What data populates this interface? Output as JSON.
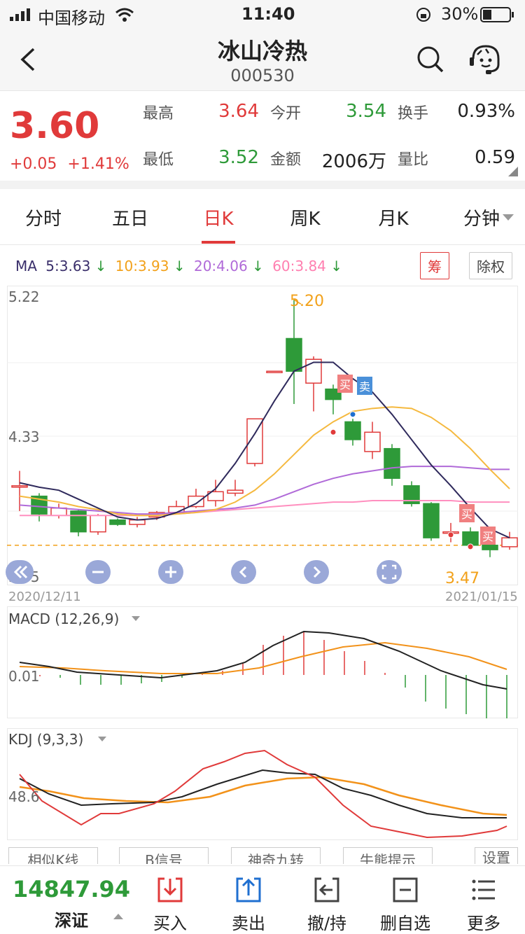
{
  "status": {
    "carrier": "中国移动",
    "time": "11:40",
    "battery": "30%"
  },
  "nav": {
    "title": "冰山冷热",
    "code": "000530"
  },
  "quote": {
    "price": "3.60",
    "change": "+0.05",
    "change_pct": "+1.41%",
    "fields": [
      {
        "label": "最高",
        "value": "3.64",
        "color": "#e03a3a"
      },
      {
        "label": "今开",
        "value": "3.54",
        "color": "#2e9a39"
      },
      {
        "label": "换手",
        "value": "0.93%",
        "color": "#222222"
      },
      {
        "label": "最低",
        "value": "3.52",
        "color": "#2e9a39"
      },
      {
        "label": "金额",
        "value": "2006万",
        "color": "#222222"
      },
      {
        "label": "量比",
        "value": "0.59",
        "color": "#222222"
      }
    ]
  },
  "tabs": {
    "t1": "分时",
    "t2": "五日",
    "t3": "日K",
    "t4": "周K",
    "t5": "月K",
    "t6": "分钟"
  },
  "ma": {
    "label": "MA",
    "items": [
      {
        "text": "5:3.63",
        "color": "#3a2f6b"
      },
      {
        "text": "10:3.93",
        "color": "#f2a11a"
      },
      {
        "text": "20:4.06",
        "color": "#b06ad8"
      },
      {
        "text": "60:3.84",
        "color": "#ff7fb0"
      }
    ],
    "chou": "筹",
    "chuquan": "除权"
  },
  "kline": {
    "y_top": "5.22",
    "y_mid": "4.33",
    "y_low": "3.45",
    "peak_label": "5.20",
    "low_label": "3.47",
    "date_start": "2020/12/11",
    "date_end": "2021/01/15",
    "buy": "买",
    "sell": "卖"
  },
  "macd": {
    "label": "MACD (12,26,9)",
    "value": "0.01"
  },
  "kdj": {
    "label": "KDJ (9,3,3)",
    "value": "48.6"
  },
  "bottom_buttons": {
    "b1": "相似K线",
    "b2": "B信号",
    "b3": "神奇九转",
    "b4": "牛熊提示",
    "b5": "设置"
  },
  "index": {
    "value": "14847.94",
    "name": "深证"
  },
  "toolbar": {
    "buy": "买入",
    "sell": "卖出",
    "cancel": "撤/持",
    "delfav": "删自选",
    "more": "更多"
  },
  "colors": {
    "red": "#e03a3a",
    "green": "#2e9a39",
    "orange": "#f2a11a",
    "blue": "#1f6fd0"
  },
  "chart_data": {
    "type": "candlestick",
    "x_range": [
      "2020/12/11",
      "2021/01/15"
    ],
    "ylim": [
      3.45,
      5.22
    ],
    "candles": [
      {
        "o": 3.95,
        "c": 3.95,
        "h": 4.05,
        "l": 3.78
      },
      {
        "o": 3.88,
        "c": 3.76,
        "h": 3.9,
        "l": 3.71
      },
      {
        "o": 3.75,
        "c": 3.8,
        "h": 3.83,
        "l": 3.73
      },
      {
        "o": 3.78,
        "c": 3.64,
        "h": 3.79,
        "l": 3.61
      },
      {
        "o": 3.64,
        "c": 3.75,
        "h": 3.76,
        "l": 3.62
      },
      {
        "o": 3.72,
        "c": 3.69,
        "h": 3.73,
        "l": 3.68
      },
      {
        "o": 3.69,
        "c": 3.72,
        "h": 3.74,
        "l": 3.67
      },
      {
        "o": 3.74,
        "c": 3.77,
        "h": 3.78,
        "l": 3.72
      },
      {
        "o": 3.77,
        "c": 3.81,
        "h": 3.85,
        "l": 3.76
      },
      {
        "o": 3.81,
        "c": 3.88,
        "h": 3.93,
        "l": 3.8
      },
      {
        "o": 3.85,
        "c": 3.91,
        "h": 3.99,
        "l": 3.81
      },
      {
        "o": 3.9,
        "c": 3.92,
        "h": 3.99,
        "l": 3.88
      },
      {
        "o": 4.1,
        "c": 4.4,
        "h": 4.4,
        "l": 4.08
      },
      {
        "o": 4.72,
        "c": 4.72,
        "h": 4.72,
        "l": 4.72
      },
      {
        "o": 4.94,
        "c": 4.72,
        "h": 5.2,
        "l": 4.5
      },
      {
        "o": 4.64,
        "c": 4.8,
        "h": 4.82,
        "l": 4.45
      },
      {
        "o": 4.6,
        "c": 4.53,
        "h": 4.63,
        "l": 4.43
      },
      {
        "o": 4.38,
        "c": 4.26,
        "h": 4.4,
        "l": 4.22
      },
      {
        "o": 4.18,
        "c": 4.31,
        "h": 4.38,
        "l": 4.13
      },
      {
        "o": 4.2,
        "c": 4.0,
        "h": 4.23,
        "l": 3.95
      },
      {
        "o": 3.95,
        "c": 3.83,
        "h": 3.98,
        "l": 3.81
      },
      {
        "o": 3.83,
        "c": 3.6,
        "h": 3.84,
        "l": 3.58
      },
      {
        "o": 3.64,
        "c": 3.64,
        "h": 3.7,
        "l": 3.57
      },
      {
        "o": 3.64,
        "c": 3.55,
        "h": 3.67,
        "l": 3.53
      },
      {
        "o": 3.55,
        "c": 3.52,
        "h": 3.56,
        "l": 3.47
      },
      {
        "o": 3.54,
        "c": 3.6,
        "h": 3.64,
        "l": 3.52
      }
    ],
    "ma5": [
      3.97,
      3.94,
      3.92,
      3.86,
      3.8,
      3.74,
      3.72,
      3.73,
      3.77,
      3.83,
      3.93,
      4.1,
      4.3,
      4.52,
      4.72,
      4.78,
      4.78,
      4.67,
      4.58,
      4.43,
      4.26,
      4.09,
      3.95,
      3.8,
      3.66,
      3.6
    ],
    "ma10": [
      3.88,
      3.86,
      3.84,
      3.81,
      3.79,
      3.76,
      3.75,
      3.75,
      3.76,
      3.77,
      3.79,
      3.84,
      3.92,
      4.03,
      4.16,
      4.29,
      4.38,
      4.45,
      4.47,
      4.48,
      4.47,
      4.41,
      4.32,
      4.2,
      4.06,
      3.93
    ],
    "ma20": [
      3.82,
      3.81,
      3.8,
      3.79,
      3.78,
      3.77,
      3.76,
      3.76,
      3.77,
      3.78,
      3.79,
      3.8,
      3.82,
      3.86,
      3.91,
      3.96,
      4.0,
      4.03,
      4.05,
      4.07,
      4.08,
      4.08,
      4.08,
      4.07,
      4.06,
      4.06
    ],
    "ma60": [
      3.75,
      3.75,
      3.75,
      3.75,
      3.75,
      3.75,
      3.75,
      3.75,
      3.76,
      3.77,
      3.78,
      3.79,
      3.8,
      3.81,
      3.82,
      3.83,
      3.84,
      3.84,
      3.85,
      3.85,
      3.85,
      3.85,
      3.85,
      3.84,
      3.84,
      3.84
    ]
  }
}
